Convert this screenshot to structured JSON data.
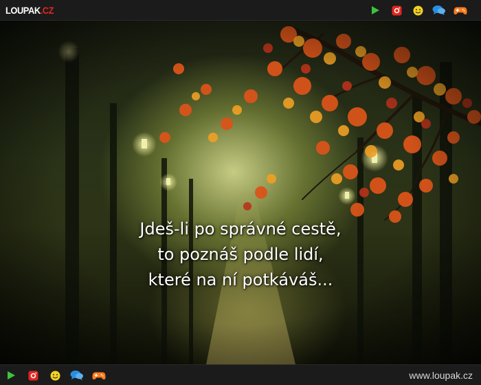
{
  "header": {
    "logo_main": "LOUPAK",
    "logo_tld": ".CZ",
    "icons": [
      "play-icon",
      "instagram-icon",
      "smiley-icon",
      "chat-icon",
      "gamepad-icon"
    ]
  },
  "image": {
    "quote_lines": [
      "Jdeš-li po správné cestě,",
      "to poznáš podle lidí,",
      "které na ní potkáváš..."
    ]
  },
  "footer": {
    "icons": [
      "play-icon",
      "instagram-icon",
      "smiley-icon",
      "chat-icon",
      "gamepad-icon"
    ],
    "site_url": "www.loupak.cz"
  },
  "colors": {
    "play": "#3cc43c",
    "instagram": "#e3261d",
    "smiley": "#f4d21f",
    "chat": "#2a8fe0",
    "gamepad": "#ff7a1a",
    "logo_tld": "#e3261d"
  }
}
